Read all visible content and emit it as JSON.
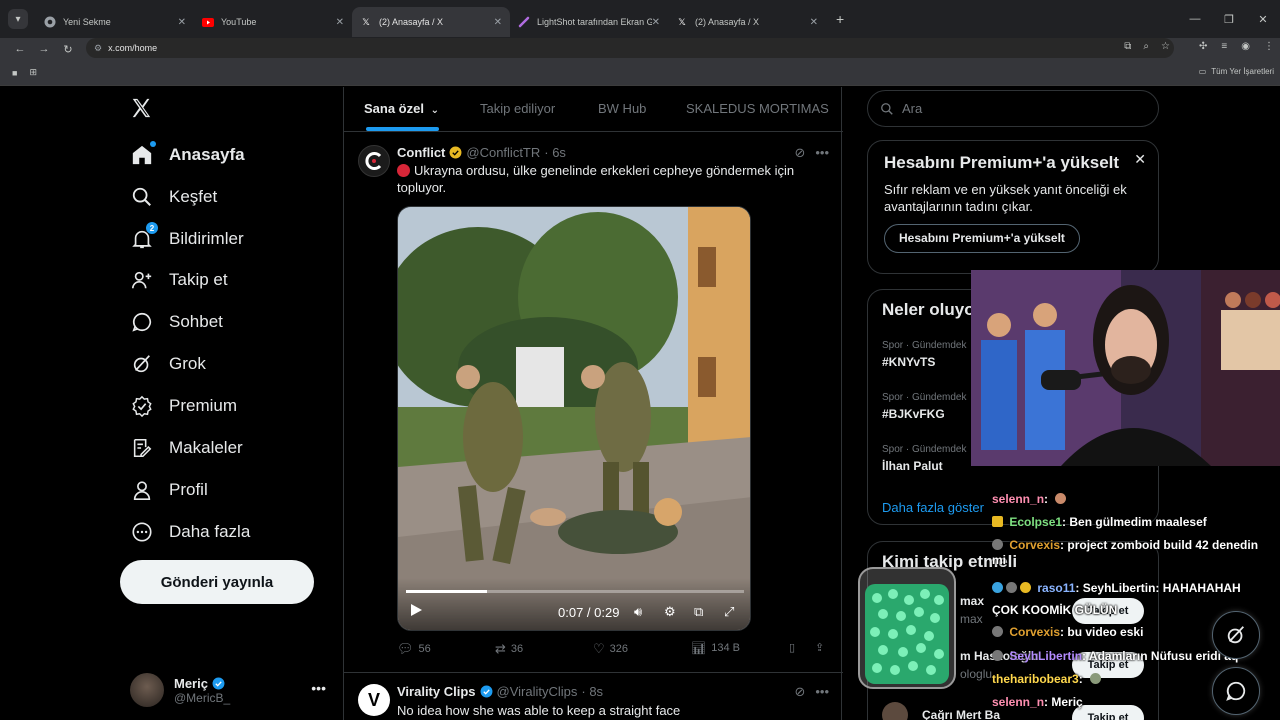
{
  "browser": {
    "tabs": [
      {
        "title": "Yeni Sekme",
        "icon": "chrome-icon",
        "active": false
      },
      {
        "title": "YouTube",
        "icon": "youtube-icon",
        "active": false
      },
      {
        "title": "(2) Anasayfa / X",
        "icon": "x-icon",
        "active": true
      },
      {
        "title": "LightShot tarafından Ekran Gör",
        "icon": "lightshot-icon",
        "active": false
      },
      {
        "title": "(2) Anasayfa / X",
        "icon": "x-icon",
        "active": false
      }
    ],
    "url": "x.com/home",
    "bookmarks_all": "Tüm Yer İşaretleri"
  },
  "leftnav": {
    "items": [
      {
        "label": "Anasayfa",
        "icon": "home-icon",
        "bold": true
      },
      {
        "label": "Keşfet",
        "icon": "search-icon"
      },
      {
        "label": "Bildirimler",
        "icon": "bell-icon",
        "badge": "2"
      },
      {
        "label": "Takip et",
        "icon": "add-person-icon"
      },
      {
        "label": "Sohbet",
        "icon": "chat-icon"
      },
      {
        "label": "Grok",
        "icon": "grok-icon"
      },
      {
        "label": "Premium",
        "icon": "premium-icon"
      },
      {
        "label": "Makaleler",
        "icon": "article-icon"
      },
      {
        "label": "Profil",
        "icon": "profile-icon"
      },
      {
        "label": "Daha fazla",
        "icon": "more-circle-icon"
      }
    ],
    "post_button": "Gönderi yayınla",
    "account": {
      "name": "Meriç",
      "handle": "@MericB_"
    }
  },
  "feed": {
    "tabs": [
      "Sana özel",
      "Takip ediliyor",
      "BW Hub",
      "SKALEDUS MORTIMAS"
    ],
    "posts": [
      {
        "name": "Conflict",
        "handle": "@ConflictTR",
        "time": "· 6s",
        "text": "Ukrayna ordusu, ülke genelinde erkekleri cepheye göndermek için topluyor.",
        "video_time": "0:07 / 0:29",
        "video_progress": 0.24,
        "replies": "56",
        "reposts": "36",
        "likes": "326",
        "views": "134 B"
      },
      {
        "name": "Virality Clips",
        "handle": "@ViralityClips",
        "time": "· 8s",
        "text": "No idea how she was able to keep a straight face"
      }
    ]
  },
  "rightcol": {
    "search_placeholder": "Ara",
    "premium": {
      "title": "Hesabını Premium+'a yükselt",
      "body": "Sıfır reklam ve en yüksek yanıt önceliği ek avantajlarının tadını çıkar.",
      "button": "Hesabını Premium+'a yükselt"
    },
    "trends": {
      "title": "Neler oluyo",
      "items": [
        {
          "category": "Spor · Gündemdek",
          "tag": "#KNYvTS"
        },
        {
          "category": "Spor · Gündemdek",
          "tag": "#BJKvFKG"
        },
        {
          "category": "Spor · Gündemdek",
          "tag": "İlhan Palut"
        }
      ],
      "show_more": "Daha fazla göster"
    },
    "who_to_follow": {
      "title": "Kimi takip etmeli",
      "frag1": "max",
      "frag2": "max",
      "frag3": "m Haskoloğlu",
      "frag4": "ologlu",
      "last_name": "Çağrı Mert Ba",
      "follow": "Takip et"
    }
  },
  "chat": {
    "lines": [
      {
        "user": "selenn_n",
        "msg": ":",
        "color": "#ff8fb1"
      },
      {
        "user": "Ecolpse1",
        "msg": ": Ben gülmedim maalesef",
        "color": "#7ee081"
      },
      {
        "user": "Corvexis",
        "msg": ": project zomboid build 42 denedin",
        "color": "#e0a030"
      },
      {
        "user": "",
        "msg": "mi",
        "color": "#ffffff"
      },
      {
        "user": "raso11",
        "msg": ": SeyhLibertin: HAHAHAHAH",
        "color": "#8ab4ff"
      },
      {
        "user": "",
        "msg": "ÇOK KOOMİK GÜLÜN",
        "color": "#ffffff"
      },
      {
        "user": "Corvexis",
        "msg": ": bu video eski",
        "color": "#e0a030"
      },
      {
        "user": "SeyhLibertin",
        "msg": ": Adamların Nüfusu eridi aq",
        "color": "#b48cff"
      },
      {
        "user": "theharibobear3",
        "msg": ":",
        "color": "#ffd84d"
      },
      {
        "user": "selenn_n",
        "msg": ": Meriç",
        "color": "#ff8fb1"
      }
    ]
  },
  "colors": {
    "accent": "#1d9bf0",
    "background": "#000000",
    "border": "#2f3336",
    "muted": "#71767b"
  }
}
